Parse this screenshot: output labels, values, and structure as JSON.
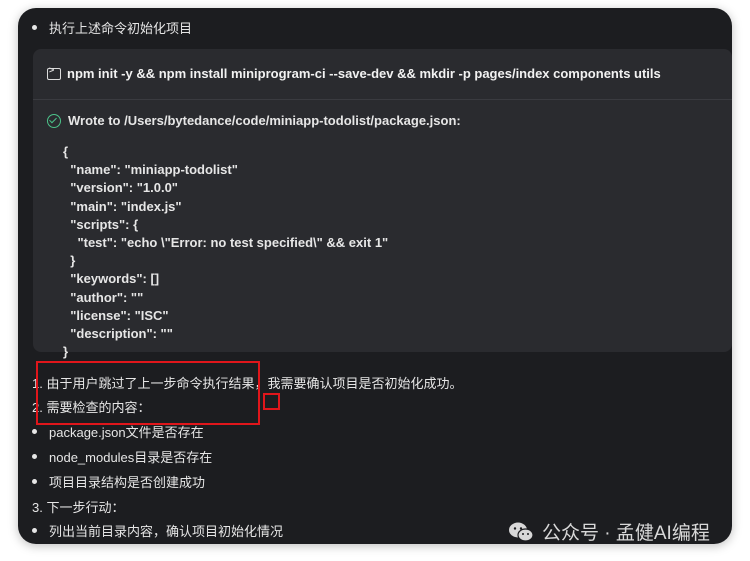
{
  "colors": {
    "panel_bg": "#1c1d20",
    "code_bg": "#2a2b2f",
    "text": "#e6e6e6",
    "success": "#4cc38a",
    "highlight": "#e0161b"
  },
  "steps": {
    "init_bullet": "执行上述命令初始化项目"
  },
  "command": {
    "icon": "terminal-icon",
    "text": "npm init -y && npm install miniprogram-ci --save-dev && mkdir -p pages/index components utils",
    "status_icon": "check-circle-icon",
    "status": "Wrote to /Users/bytedance/code/miniapp-todolist/package.json:",
    "output_lines": [
      "{",
      "  \"name\": \"miniapp-todolist\"",
      "  \"version\": \"1.0.0\"",
      "  \"main\": \"index.js\"",
      "  \"scripts\": {",
      "    \"test\": \"echo \\\"Error: no test specified\\\" && exit 1\"",
      "  }",
      "  \"keywords\": []",
      "  \"author\": \"\"",
      "  \"license\": \"ISC\"",
      "  \"description\": \"\"",
      "}"
    ]
  },
  "analysis": {
    "item1": "1. 由于用户跳过了上一步命令执行结果，我需要确认项目是否初始化成功。",
    "item2": "2. 需要检查的内容：",
    "checks": [
      "package.json文件是否存在",
      "node_modules目录是否存在",
      "项目目录结构是否创建成功"
    ],
    "item3": "3. 下一步行动：",
    "next": [
      "列出当前目录内容，确认项目初始化情况"
    ]
  },
  "watermark": {
    "icon": "wechat-icon",
    "text": "公众号 · 孟健AI编程"
  }
}
